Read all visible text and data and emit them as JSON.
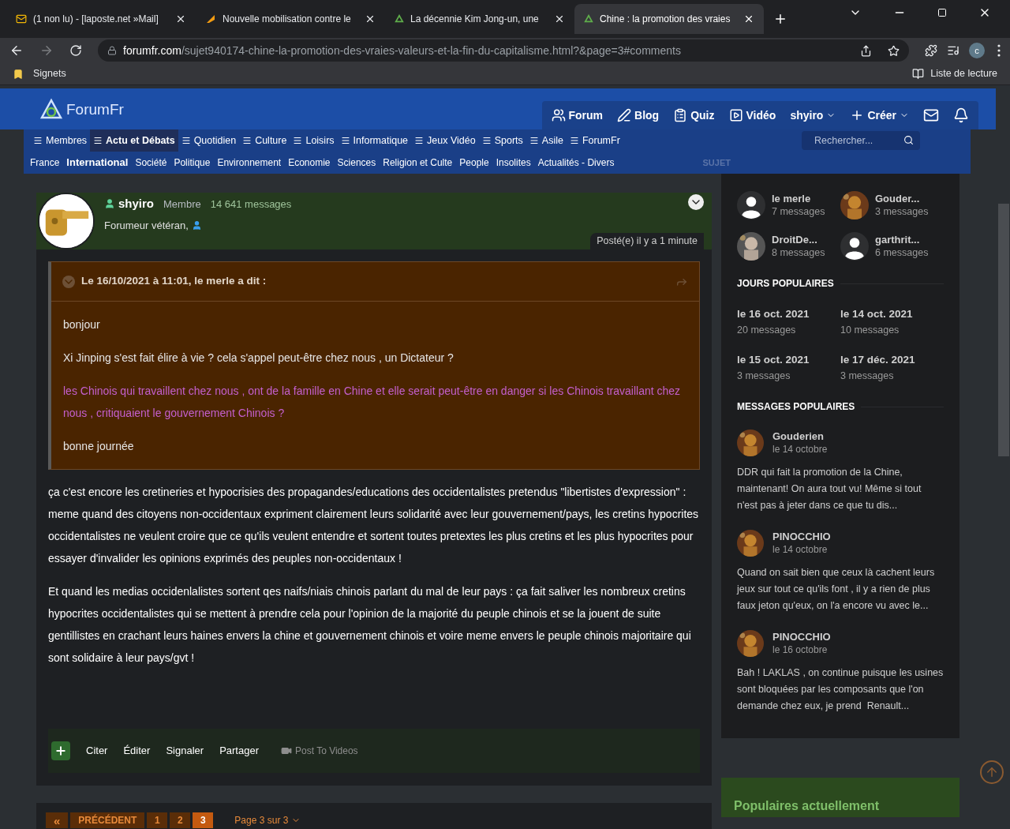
{
  "browser": {
    "tabs": [
      {
        "title": "(1 non lu) - [laposte.net »Mail]",
        "selected": false
      },
      {
        "title": "Nouvelle mobilisation contre le",
        "selected": false
      },
      {
        "title": "La décennie Kim Jong-un, une",
        "selected": false
      },
      {
        "title": "Chine : la promotion des vraies",
        "selected": true
      }
    ],
    "url_domain": "forumfr.com",
    "url_path": "/sujet940174-chine-la-promotion-des-vraies-valeurs-et-la-fin-du-capitalisme.html?&page=3#comments",
    "profile": "c",
    "bookmarks": "Signets",
    "reading_list": "Liste de lecture"
  },
  "site": {
    "logo": "ForumFr",
    "top_nav": [
      "Forum",
      "Blog",
      "Quiz",
      "Vidéo",
      "shyiro",
      "Créer"
    ],
    "menu": [
      {
        "label": "Membres",
        "selected": false
      },
      {
        "label": "Actu et Débats",
        "selected": true
      },
      {
        "label": "Quotidien",
        "selected": false
      },
      {
        "label": "Culture",
        "selected": false
      },
      {
        "label": "Loisirs",
        "selected": false
      },
      {
        "label": "Informatique",
        "selected": false
      },
      {
        "label": "Jeux Vidéo",
        "selected": false
      },
      {
        "label": "Sports",
        "selected": false
      },
      {
        "label": "Asile",
        "selected": false
      },
      {
        "label": "ForumFr",
        "selected": false
      }
    ],
    "search": {
      "placeholder": "Rechercher..."
    },
    "submenu": [
      {
        "label": "France",
        "selected": false
      },
      {
        "label": "International",
        "selected": true
      },
      {
        "label": "Société",
        "selected": false
      },
      {
        "label": "Politique",
        "selected": false
      },
      {
        "label": "Environnement",
        "selected": false
      },
      {
        "label": "Economie",
        "selected": false
      },
      {
        "label": "Sciences",
        "selected": false
      },
      {
        "label": "Religion et Culte",
        "selected": false
      },
      {
        "label": "People",
        "selected": false
      },
      {
        "label": "Insolites",
        "selected": false
      },
      {
        "label": "Actualités - Divers",
        "selected": false
      }
    ]
  },
  "post": {
    "author": "shyiro",
    "role": "Membre",
    "count": "14 641 messages",
    "title": "Forumeur vétéran,",
    "posted": "Posté(e) il y a 1 minute",
    "quote": {
      "header": "Le 16/10/2021 à 11:01, le merle a dit :",
      "paragraphs": [
        {
          "text": "bonjour",
          "highlight": false
        },
        {
          "text": "Xi Jinping s'est fait élire à vie ? cela s'appel peut-être chez nous , un Dictateur ?",
          "highlight": false
        },
        {
          "text": "les Chinois qui travaillent chez nous , ont de la famille en Chine et elle serait peut-être en danger si les Chinois travaillant chez nous , critiquaient le gouvernement Chinois ?",
          "highlight": true
        },
        {
          "text": "bonne journée",
          "highlight": false
        }
      ]
    },
    "body": [
      "ça c'est encore les cretineries et hypocrisies des propagandes/educations des occidentalistes pretendus \"libertistes d'expression\" : meme quand des citoyens non-occidentaux expriment clairement leurs solidarité avec leur gouvernement/pays, les cretins hypocrites occidentalistes ne veulent croire que ce qu'ils veulent entendre et sortent toutes pretextes les plus cretins et les plus hypocrites pour essayer d'invalider les opinions exprimés des peuples non-occidentaux !",
      "Et quand les medias occidenlalistes sortent qes naifs/niais chinois parlant du mal de leur pays : ça fait saliver les nombreux cretins hypocrites occidentalistes qui se mettent à prendre cela pour l'opinion de la majorité du peuple chinois et se la jouent de suite gentillistes en crachant leurs haines envers la chine et gouvernement chinois et voire meme envers le peuple chinois majoritaire qui sont solidaire à leur pays/gvt !"
    ],
    "actions": [
      "Citer",
      "Éditer",
      "Signaler",
      "Partager"
    ],
    "video_action": "Post To Videos"
  },
  "pagination": {
    "first": "«",
    "prev": "PRÉCÉDENT",
    "pages": [
      {
        "label": "1",
        "selected": false
      },
      {
        "label": "2",
        "selected": false
      },
      {
        "label": "3",
        "selected": true
      }
    ],
    "summary": "Page 3 sur 3"
  },
  "sidebar": {
    "cut_heading": "SUJET",
    "participants": [
      {
        "name": "le merle",
        "count": "7 messages",
        "kind": "default"
      },
      {
        "name": "Gouder...",
        "count": "3 messages",
        "kind": "picture"
      },
      {
        "name": "DroitDe...",
        "count": "8 messages",
        "kind": "picture"
      },
      {
        "name": "garthrit...",
        "count": "6 messages",
        "kind": "default"
      }
    ],
    "days_heading": "JOURS POPULAIRES",
    "days": [
      {
        "date": "le 16 oct. 2021",
        "count": "20 messages"
      },
      {
        "date": "le 14 oct. 2021",
        "count": "10 messages"
      },
      {
        "date": "le 15 oct. 2021",
        "count": "3 messages"
      },
      {
        "date": "le 17 déc. 2021",
        "count": "3 messages"
      }
    ],
    "messages_heading": "MESSAGES POPULAIRES",
    "messages": [
      {
        "author": "Gouderien",
        "date": "le 14 octobre",
        "text": "DDR qui fait la promotion de la Chine, maintenant! On aura tout vu! Même si tout n'est pas à jeter dans ce que tu dis..."
      },
      {
        "author": "PINOCCHIO",
        "date": "le 14 octobre",
        "text": "Quand on sait bien que ceux là cachent leurs jeux sur tout ce qu'ils font , il y a rien de plus faux jeton qu'eux, on l'a encore vu avec le..."
      },
      {
        "author": "PINOCCHIO",
        "date": "le 16 octobre",
        "text": "Bah ! LAKLAS , on continue puisque les usines sont bloquées par les composants que l'on demande chez eux, je prend  Renault..."
      }
    ],
    "popular_heading": "Populaires actuellement"
  }
}
